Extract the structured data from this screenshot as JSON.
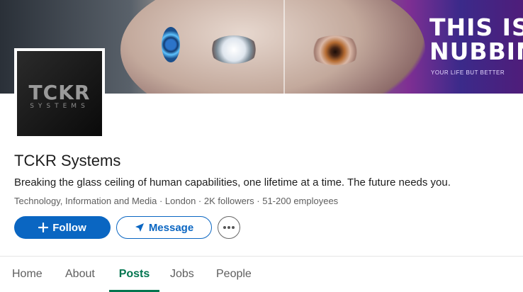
{
  "banner": {
    "headline_line1": "THIS IS",
    "headline_line2": "NUBBIN",
    "tagline": "YOUR LIFE BUT BETTER"
  },
  "logo": {
    "word": "TCKR",
    "sub": "SYSTEMS"
  },
  "company": {
    "name": "TCKR Systems",
    "tagline": "Breaking the glass ceiling of human capabilities, one lifetime at a time. The future needs you.",
    "meta": "Technology, Information and Media · London · 2K followers · 51-200 employees"
  },
  "actions": {
    "follow_label": "Follow",
    "message_label": "Message",
    "more_icon": "more-horizontal-icon"
  },
  "tabs": [
    {
      "label": "Home",
      "active": false
    },
    {
      "label": "About",
      "active": false
    },
    {
      "label": "Posts",
      "active": true
    },
    {
      "label": "Jobs",
      "active": false
    },
    {
      "label": "People",
      "active": false
    }
  ],
  "colors": {
    "primary": "#0a66c2",
    "tab_active": "#01754f",
    "text": "#1d1d1d",
    "muted": "#5e5e5e"
  }
}
